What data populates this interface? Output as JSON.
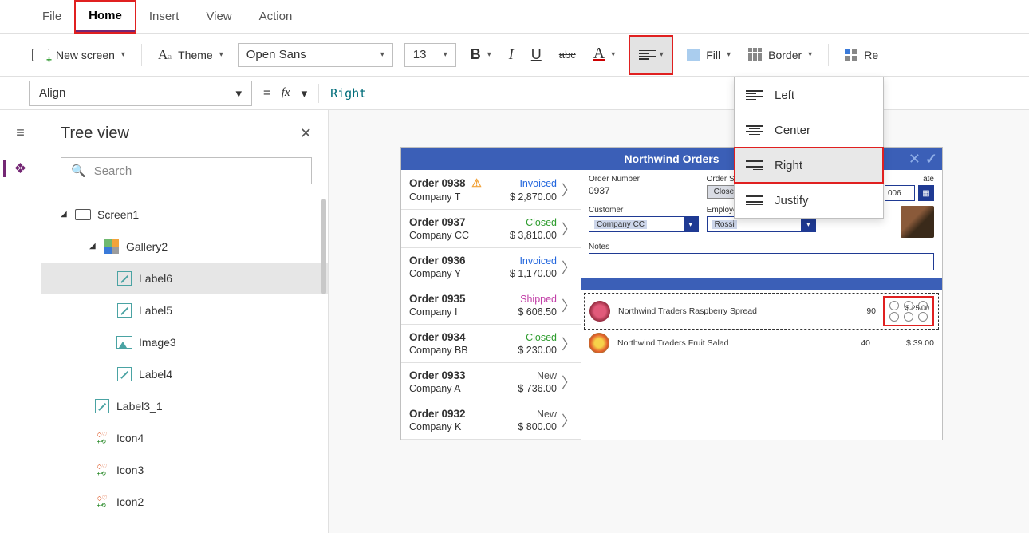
{
  "menubar": {
    "file": "File",
    "home": "Home",
    "insert": "Insert",
    "view": "View",
    "action": "Action"
  },
  "ribbon": {
    "new_screen": "New screen",
    "theme": "Theme",
    "font_name": "Open Sans",
    "font_size": "13",
    "fill": "Fill",
    "border": "Border",
    "reorder_short": "Re"
  },
  "formula": {
    "property": "Align",
    "equals": "=",
    "fx": "fx",
    "value": "Right"
  },
  "alignMenu": {
    "left": "Left",
    "center": "Center",
    "right": "Right",
    "justify": "Justify"
  },
  "treeview": {
    "title": "Tree view",
    "search_placeholder": "Search",
    "nodes": {
      "screen1": "Screen1",
      "gallery2": "Gallery2",
      "label6": "Label6",
      "label5": "Label5",
      "image3": "Image3",
      "label4": "Label4",
      "label3_1": "Label3_1",
      "icon4": "Icon4",
      "icon3": "Icon3",
      "icon2": "Icon2"
    }
  },
  "app": {
    "title": "Northwind Orders",
    "detail": {
      "order_number_label": "Order Number",
      "order_number": "0937",
      "order_status_label": "Order Status",
      "order_status": "Closed",
      "date_label_suffix": "ate",
      "date_value": "006",
      "customer_label": "Customer",
      "customer": "Company CC",
      "employee_label": "Employee",
      "employee": "Rossi",
      "notes_label": "Notes"
    },
    "orders": [
      {
        "num": "Order 0938",
        "alert": true,
        "status": "Invoiced",
        "status_class": "st-invoiced",
        "company": "Company T",
        "amount": "$ 2,870.00"
      },
      {
        "num": "Order 0937",
        "alert": false,
        "status": "Closed",
        "status_class": "st-closed",
        "company": "Company CC",
        "amount": "$ 3,810.00"
      },
      {
        "num": "Order 0936",
        "alert": false,
        "status": "Invoiced",
        "status_class": "st-invoiced",
        "company": "Company Y",
        "amount": "$ 1,170.00"
      },
      {
        "num": "Order 0935",
        "alert": false,
        "status": "Shipped",
        "status_class": "st-shipped",
        "company": "Company I",
        "amount": "$ 606.50"
      },
      {
        "num": "Order 0934",
        "alert": false,
        "status": "Closed",
        "status_class": "st-closed",
        "company": "Company BB",
        "amount": "$ 230.00"
      },
      {
        "num": "Order 0933",
        "alert": false,
        "status": "New",
        "status_class": "st-new",
        "company": "Company A",
        "amount": "$ 736.00"
      },
      {
        "num": "Order 0932",
        "alert": false,
        "status": "New",
        "status_class": "st-new",
        "company": "Company K",
        "amount": "$ 800.00"
      }
    ],
    "lineItems": [
      {
        "name": "Northwind Traders Raspberry Spread",
        "qty": "90",
        "price": "$ 25.00",
        "selected": true,
        "thumb": "thumb-red"
      },
      {
        "name": "Northwind Traders Fruit Salad",
        "qty": "40",
        "price": "$ 39.00",
        "selected": false,
        "thumb": "thumb-fruit"
      }
    ]
  }
}
